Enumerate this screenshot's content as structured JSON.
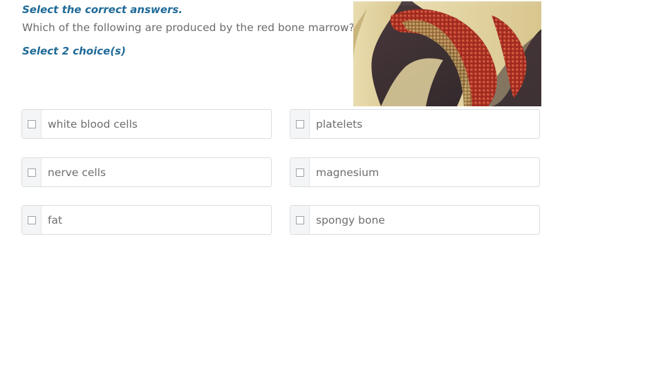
{
  "header": {
    "instruction": "Select the correct answers.",
    "question": "Which of the following are produced by the red bone marrow?",
    "choice_count": "Select 2 choice(s)"
  },
  "options": [
    {
      "label": "white blood cells",
      "checked": false
    },
    {
      "label": "platelets",
      "checked": false
    },
    {
      "label": "nerve cells",
      "checked": false
    },
    {
      "label": "magnesium",
      "checked": false
    },
    {
      "label": "fat",
      "checked": false
    },
    {
      "label": "spongy bone",
      "checked": false
    }
  ],
  "colors": {
    "accent": "#1f6a97",
    "text_gray": "#6b6b6b",
    "border": "#d9dde0"
  }
}
